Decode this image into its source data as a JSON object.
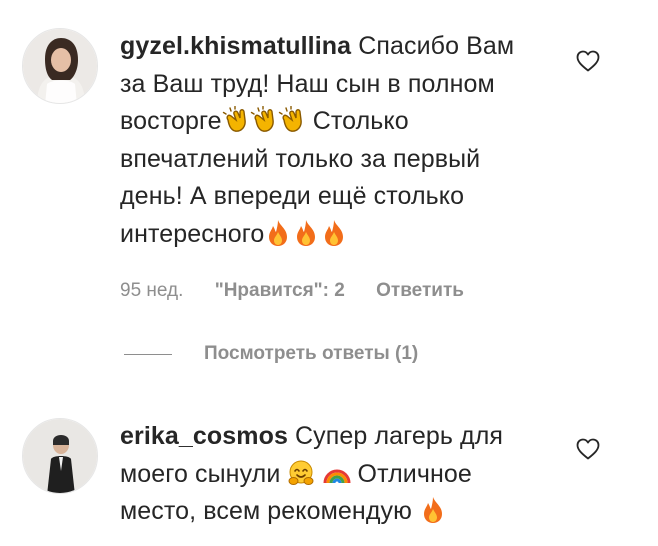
{
  "comments": [
    {
      "username": "gyzel.khismatullina",
      "text_a": "Спасибо Вам за Ваш труд! Наш сын в полном восторге",
      "text_b": " Столько впечатлений только за первый день! А впереди ещё столько интересного",
      "emojis_a": [
        "clapping-hands",
        "clapping-hands",
        "clapping-hands"
      ],
      "emojis_b": [
        "fire",
        "fire",
        "fire"
      ],
      "time": "95 нед.",
      "likes": "\"Нравится\": 2",
      "reply": "Ответить",
      "view_replies": "Посмотреть ответы (1)"
    },
    {
      "username": "erika_cosmos",
      "text_a": "Супер лагерь для моего сынули",
      "text_b": " Отличное место, всем рекомендую",
      "emojis": [
        "hugging-face",
        "rainbow",
        "fire"
      ]
    }
  ],
  "colors": {
    "text": "#262626",
    "secondary": "#8e8e8e",
    "background": "#ffffff"
  }
}
